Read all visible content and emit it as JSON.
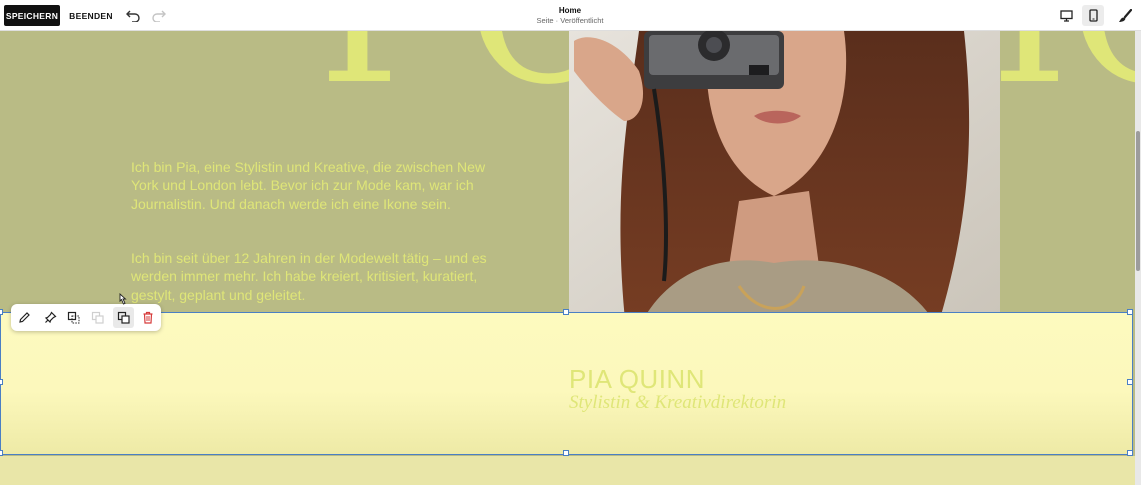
{
  "topbar": {
    "save_label": "SPEICHERN",
    "exit_label": "BEENDEN",
    "page_title": "Home",
    "page_subtitle": "Seite · Veröffentlicht"
  },
  "hero": {
    "big_word_left": "POR",
    "big_word_right": "IO"
  },
  "bio": {
    "paragraph_1": "Ich bin Pia, eine Stylistin und Kreative, die zwischen New York und London lebt. Bevor ich zur Mode kam, war ich Journalistin. Und danach werde ich eine Ikone sein.",
    "paragraph_2": "Ich bin seit über 12 Jahren in der Modewelt tätig – und es werden immer mehr. Ich habe kreiert, kritisiert, kuratiert, gestylt, geplant und geleitet."
  },
  "profile": {
    "name": "PIA QUINN",
    "role": "Stylistin & Kreativdirektorin"
  },
  "block_toolbar": {
    "tools": [
      "pencil-icon",
      "pin-icon",
      "duplicate-icon",
      "copy-disabled-icon",
      "layer-forward-icon",
      "trash-icon"
    ]
  },
  "colors": {
    "background": "#b9bb85",
    "accent_text": "#dfe678",
    "selection_border": "#4a7fc4",
    "selection_fill": "#fcf8bc",
    "delete": "#d63b3b"
  }
}
